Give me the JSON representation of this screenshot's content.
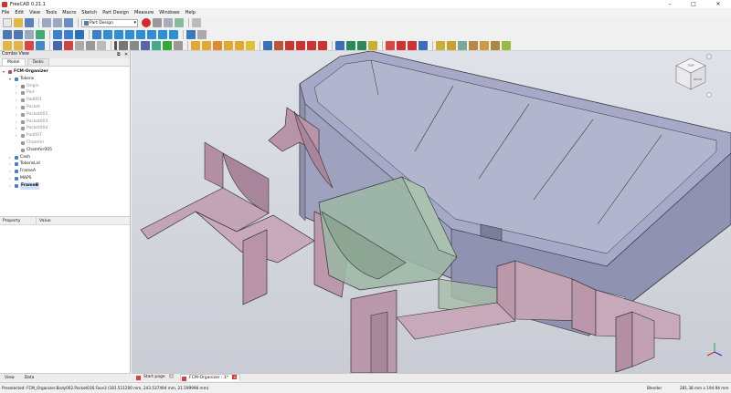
{
  "window": {
    "title": "FreeCAD 0.21.1",
    "minimize": "–",
    "maximize": "□",
    "close": "✕"
  },
  "menu": [
    "File",
    "Edit",
    "View",
    "Tools",
    "Macro",
    "Sketch",
    "Part Design",
    "Measure",
    "Windows",
    "Help"
  ],
  "workbench": {
    "selected": "Part Design"
  },
  "combo": {
    "title": "Combo View",
    "tabs": [
      "Model",
      "Tasks"
    ],
    "tree": [
      {
        "label": "FCM-Organizer",
        "level": 0,
        "expanded": true,
        "kind": "doc",
        "bold": true
      },
      {
        "label": "Tokens",
        "level": 1,
        "expanded": true,
        "kind": "body"
      },
      {
        "label": "Origin",
        "level": 2,
        "kind": "origin",
        "dim": true
      },
      {
        "label": "Pad",
        "level": 2,
        "kind": "feature",
        "dim": true
      },
      {
        "label": "Pad001",
        "level": 2,
        "kind": "feature",
        "dim": true
      },
      {
        "label": "Pocket",
        "level": 2,
        "kind": "feature",
        "dim": true
      },
      {
        "label": "Pocket001",
        "level": 2,
        "kind": "feature",
        "dim": true
      },
      {
        "label": "Pocket003",
        "level": 2,
        "kind": "feature",
        "dim": true
      },
      {
        "label": "Pocket004",
        "level": 2,
        "kind": "feature",
        "dim": true
      },
      {
        "label": "Pad007",
        "level": 2,
        "kind": "feature",
        "dim": true
      },
      {
        "label": "Chamfer",
        "level": 2,
        "kind": "feature",
        "dim": true,
        "noarrow": true
      },
      {
        "label": "Chamfer005",
        "level": 2,
        "kind": "feature",
        "noarrow": true
      },
      {
        "label": "Cash",
        "level": 1,
        "kind": "body"
      },
      {
        "label": "TokensLid",
        "level": 1,
        "kind": "body"
      },
      {
        "label": "FrameA",
        "level": 1,
        "kind": "body"
      },
      {
        "label": "MAPS",
        "level": 1,
        "kind": "body"
      },
      {
        "label": "FrameB",
        "level": 1,
        "kind": "body",
        "selected": true,
        "bold": true
      }
    ]
  },
  "property": {
    "col_property": "Property",
    "col_value": "Value"
  },
  "bottom_tabs": [
    "View",
    "Data"
  ],
  "doc_tabs": [
    {
      "label": "Start page",
      "active": false
    },
    {
      "label": "FCM-Organizer : 1*",
      "active": true
    }
  ],
  "status": {
    "preselected": "Preselected: FCM_Organizer.Body002.Pocket016.Face3 (181.511200 mm, 243.537494 mm, 21.599998 mm)",
    "nav_style": "Blender",
    "dimensions": "281.38 mm x 194.94 mm"
  },
  "navcube": {
    "face": "TOP",
    "side": "RIGHT"
  }
}
